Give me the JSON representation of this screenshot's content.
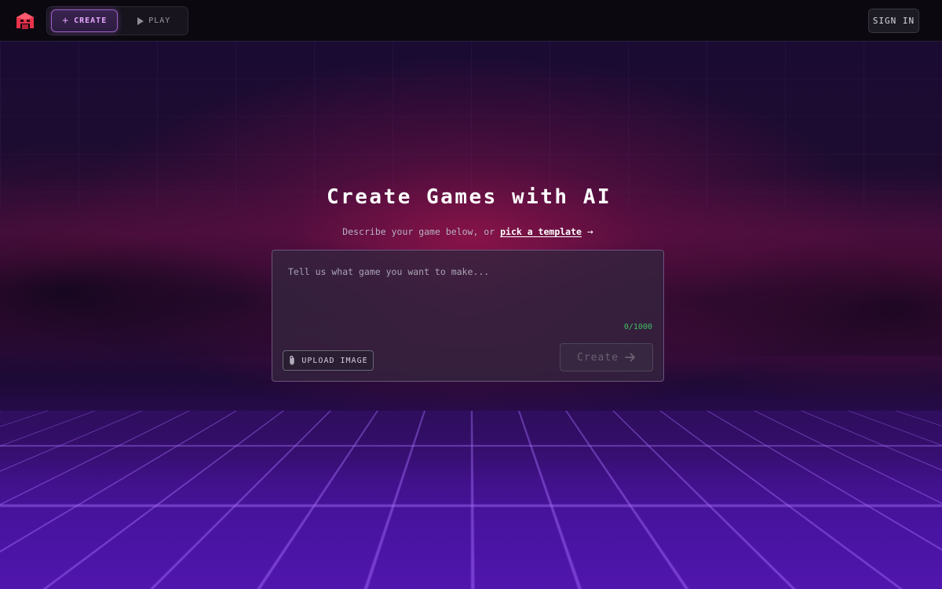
{
  "header": {
    "logo_icon": "robot-head-logo-icon",
    "mode_toggle": {
      "create_label": "CREATE",
      "play_label": "PLAY",
      "active": "CREATE"
    },
    "sign_in_label": "SIGN IN"
  },
  "hero": {
    "title": "Create Games with AI",
    "subtitle_prefix": "Describe your game below, or",
    "template_link": "pick a template",
    "arrow_glyph": "→"
  },
  "prompt": {
    "placeholder": "Tell us what game you want to make...",
    "value": "",
    "char_count": "0/1000",
    "upload_label": "UPLOAD IMAGE",
    "create_label": "Create"
  },
  "colors": {
    "accent": "#e6a6ff",
    "count_green": "#3fbf62",
    "grid_purple": "#5016b0"
  }
}
